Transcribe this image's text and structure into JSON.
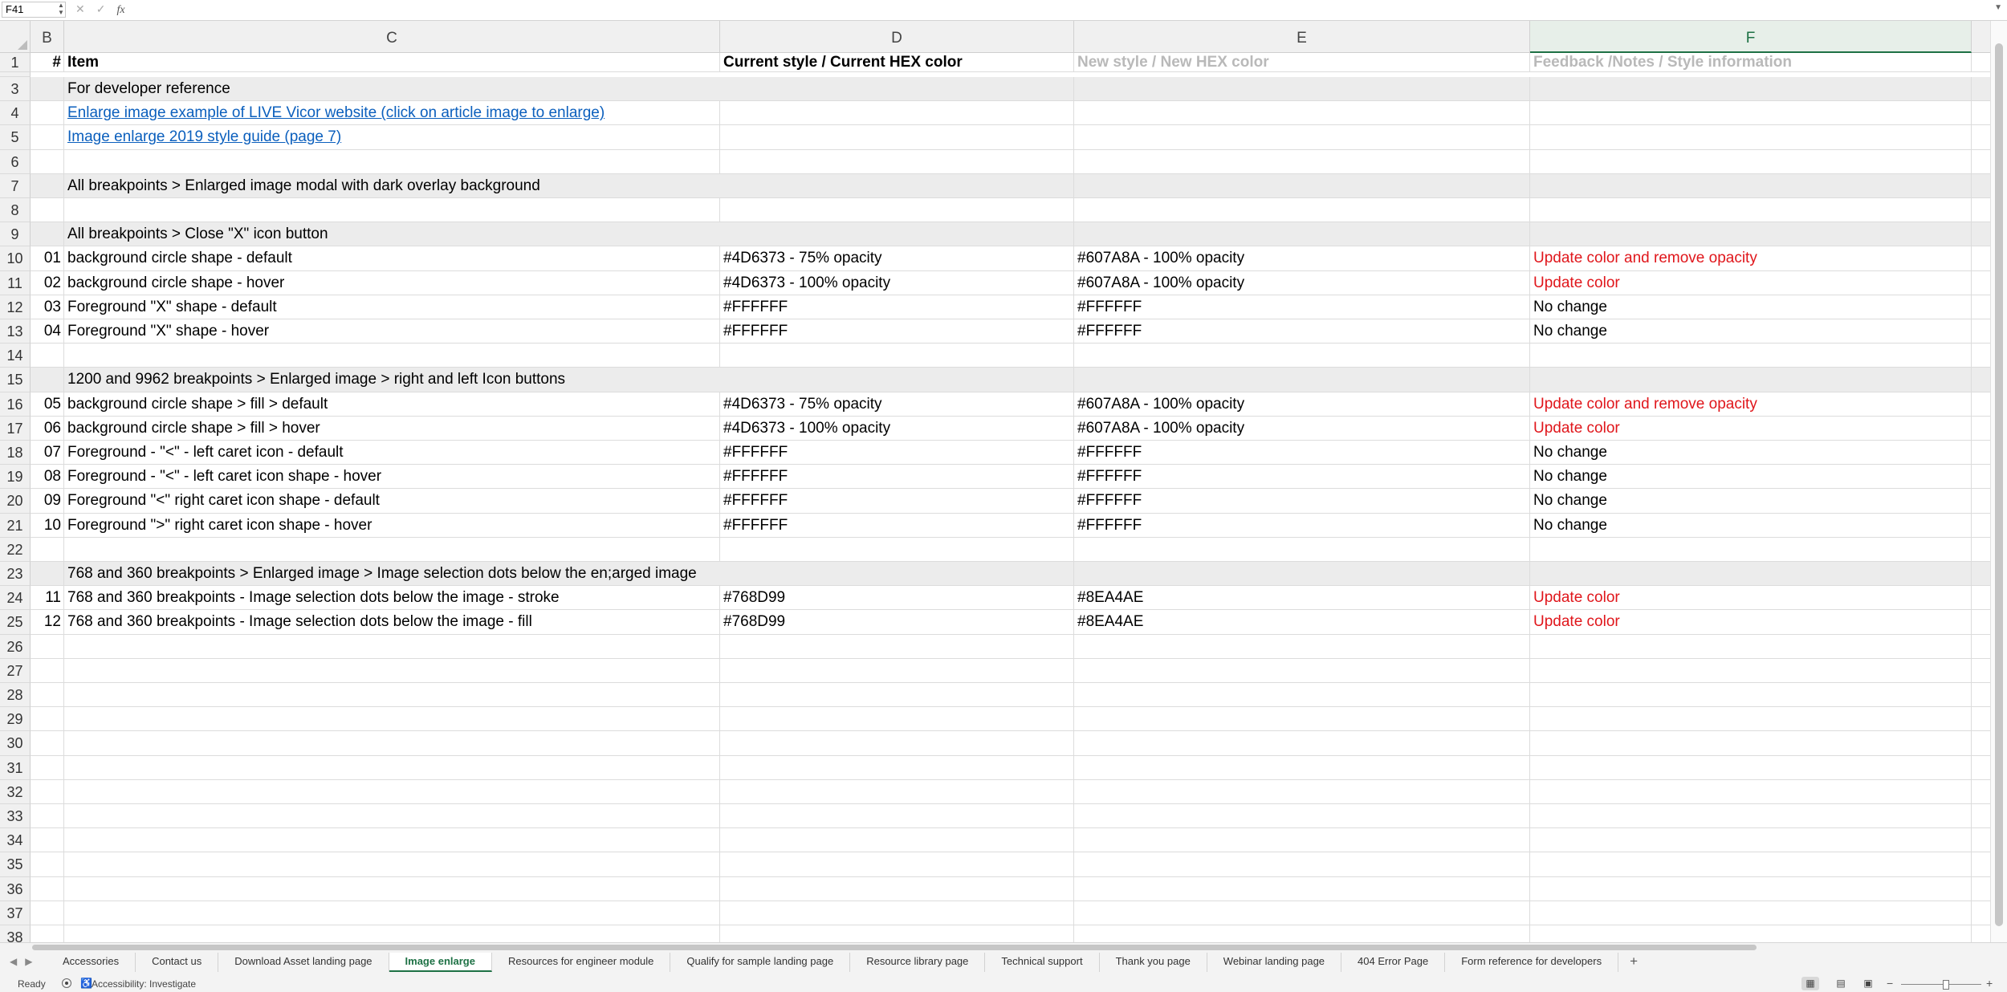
{
  "formula_bar": {
    "name_box": "F41",
    "formula": ""
  },
  "columns": [
    {
      "id": "col-b",
      "label": "B",
      "active": false
    },
    {
      "id": "col-c",
      "label": "C",
      "active": false
    },
    {
      "id": "col-d",
      "label": "D",
      "active": false
    },
    {
      "id": "col-e",
      "label": "E",
      "active": false
    },
    {
      "id": "col-f",
      "label": "F",
      "active": true
    }
  ],
  "rows": [
    {
      "n": "1",
      "num": "#",
      "item": "Item",
      "current": "Current style / Current HEX color",
      "new": "New style / New HEX color",
      "feedback": "Feedback /Notes / Style information",
      "kind": "header"
    },
    {
      "n": "3",
      "num": "",
      "item": "For developer reference",
      "current": "",
      "new": "",
      "feedback": "",
      "kind": "band"
    },
    {
      "n": "4",
      "num": "",
      "item": "Enlarge image example of LIVE Vicor website (click on article image to enlarge)",
      "current": "",
      "new": "",
      "feedback": "",
      "kind": "link"
    },
    {
      "n": "5",
      "num": "",
      "item": "Image enlarge 2019 style guide (page 7)",
      "current": "",
      "new": "",
      "feedback": "",
      "kind": "link"
    },
    {
      "n": "6",
      "num": "",
      "item": "",
      "current": "",
      "new": "",
      "feedback": "",
      "kind": "normal"
    },
    {
      "n": "7",
      "num": "",
      "item": "All breakpoints > Enlarged image modal with dark overlay background",
      "current": "",
      "new": "",
      "feedback": "",
      "kind": "band"
    },
    {
      "n": "8",
      "num": "",
      "item": "",
      "current": "",
      "new": "",
      "feedback": "",
      "kind": "normal"
    },
    {
      "n": "9",
      "num": "",
      "item": "All breakpoints  > Close \"X\" icon button",
      "current": "",
      "new": "",
      "feedback": "",
      "kind": "band"
    },
    {
      "n": "10",
      "num": "01",
      "item": "background circle shape - default",
      "current": "#4D6373 - 75% opacity",
      "new": "#607A8A - 100% opacity",
      "feedback": "Update color and remove opacity",
      "kind": "normal",
      "fb_red": true
    },
    {
      "n": "11",
      "num": "02",
      "item": "background circle shape - hover",
      "current": "#4D6373 - 100% opacity",
      "new": "#607A8A - 100% opacity",
      "feedback": "Update color",
      "kind": "normal",
      "fb_red": true
    },
    {
      "n": "12",
      "num": "03",
      "item": "Foreground \"X\" shape - default",
      "current": "#FFFFFF",
      "new": "#FFFFFF",
      "feedback": "No change",
      "kind": "normal"
    },
    {
      "n": "13",
      "num": "04",
      "item": "Foreground \"X\" shape - hover",
      "current": "#FFFFFF",
      "new": "#FFFFFF",
      "feedback": "No change",
      "kind": "normal"
    },
    {
      "n": "14",
      "num": "",
      "item": "",
      "current": "",
      "new": "",
      "feedback": "",
      "kind": "normal"
    },
    {
      "n": "15",
      "num": "",
      "item": "1200 and 9962 breakpoints > Enlarged image > right and left Icon buttons",
      "current": "",
      "new": "",
      "feedback": "",
      "kind": "band"
    },
    {
      "n": "16",
      "num": "05",
      "item": "background circle shape > fill > default",
      "current": "#4D6373 - 75% opacity",
      "new": "#607A8A - 100% opacity",
      "feedback": "Update color and remove opacity",
      "kind": "normal",
      "fb_red": true
    },
    {
      "n": "17",
      "num": "06",
      "item": "background circle shape > fill > hover",
      "current": "#4D6373 - 100% opacity",
      "new": "#607A8A - 100% opacity",
      "feedback": "Update color",
      "kind": "normal",
      "fb_red": true
    },
    {
      "n": "18",
      "num": "07",
      "item": "Foreground  - \"<\" - left caret icon - default",
      "current": "#FFFFFF",
      "new": "#FFFFFF",
      "feedback": "No change",
      "kind": "normal"
    },
    {
      "n": "19",
      "num": "08",
      "item": "Foreground  - \"<\" - left caret icon shape   - hover",
      "current": "#FFFFFF",
      "new": "#FFFFFF",
      "feedback": "No change",
      "kind": "normal"
    },
    {
      "n": "20",
      "num": "09",
      "item": "Foreground \"<\" right caret icon shape - default",
      "current": "#FFFFFF",
      "new": "#FFFFFF",
      "feedback": "No change",
      "kind": "normal"
    },
    {
      "n": "21",
      "num": "10",
      "item": "Foreground \">\" right caret icon  shape - hover",
      "current": "#FFFFFF",
      "new": "#FFFFFF",
      "feedback": "No change",
      "kind": "normal"
    },
    {
      "n": "22",
      "num": "",
      "item": "",
      "current": "",
      "new": "",
      "feedback": "",
      "kind": "normal"
    },
    {
      "n": "23",
      "num": "",
      "item": "768 and 360 breakpoints > Enlarged image > Image selection dots below the en;arged image",
      "current": "",
      "new": "",
      "feedback": "",
      "kind": "band"
    },
    {
      "n": "24",
      "num": "11",
      "item": "768 and 360 breakpoints - Image selection dots below the image - stroke",
      "current": "#768D99",
      "new": "#8EA4AE",
      "feedback": "Update color",
      "kind": "normal",
      "fb_red": true
    },
    {
      "n": "25",
      "num": "12",
      "item": "768 and 360 breakpoints - Image selection dots below the image - fill",
      "current": "#768D99",
      "new": "#8EA4AE",
      "feedback": "Update color",
      "kind": "normal",
      "fb_red": true
    },
    {
      "n": "26",
      "num": "",
      "item": "",
      "current": "",
      "new": "",
      "feedback": "",
      "kind": "normal"
    },
    {
      "n": "27",
      "num": "",
      "item": "",
      "current": "",
      "new": "",
      "feedback": "",
      "kind": "normal"
    },
    {
      "n": "28",
      "num": "",
      "item": "",
      "current": "",
      "new": "",
      "feedback": "",
      "kind": "normal"
    },
    {
      "n": "29",
      "num": "",
      "item": "",
      "current": "",
      "new": "",
      "feedback": "",
      "kind": "normal"
    },
    {
      "n": "30",
      "num": "",
      "item": "",
      "current": "",
      "new": "",
      "feedback": "",
      "kind": "normal"
    },
    {
      "n": "31",
      "num": "",
      "item": "",
      "current": "",
      "new": "",
      "feedback": "",
      "kind": "normal"
    },
    {
      "n": "32",
      "num": "",
      "item": "",
      "current": "",
      "new": "",
      "feedback": "",
      "kind": "normal"
    },
    {
      "n": "33",
      "num": "",
      "item": "",
      "current": "",
      "new": "",
      "feedback": "",
      "kind": "normal"
    },
    {
      "n": "34",
      "num": "",
      "item": "",
      "current": "",
      "new": "",
      "feedback": "",
      "kind": "normal"
    },
    {
      "n": "35",
      "num": "",
      "item": "",
      "current": "",
      "new": "",
      "feedback": "",
      "kind": "normal"
    },
    {
      "n": "36",
      "num": "",
      "item": "",
      "current": "",
      "new": "",
      "feedback": "",
      "kind": "normal"
    },
    {
      "n": "37",
      "num": "",
      "item": "",
      "current": "",
      "new": "",
      "feedback": "",
      "kind": "normal"
    },
    {
      "n": "38",
      "num": "",
      "item": "",
      "current": "",
      "new": "",
      "feedback": "",
      "kind": "normal"
    }
  ],
  "sheet_tabs": [
    {
      "label": "Accessories",
      "active": false
    },
    {
      "label": "Contact us",
      "active": false
    },
    {
      "label": "Download Asset landing page",
      "active": false
    },
    {
      "label": "Image enlarge",
      "active": true
    },
    {
      "label": "Resources for engineer module",
      "active": false
    },
    {
      "label": "Qualify for sample landing page",
      "active": false
    },
    {
      "label": "Resource library page",
      "active": false
    },
    {
      "label": "Technical support",
      "active": false
    },
    {
      "label": "Thank you page",
      "active": false
    },
    {
      "label": "Webinar landing page",
      "active": false
    },
    {
      "label": "404 Error Page",
      "active": false
    },
    {
      "label": "Form reference for developers",
      "active": false
    }
  ],
  "status": {
    "ready": "Ready",
    "accessibility": "Accessibility: Investigate"
  },
  "icons": {
    "add_sheet": "+",
    "cancel": "✕",
    "confirm": "✓",
    "fx": "fx"
  },
  "colors": {
    "accent_green": "#1e7145",
    "link_blue": "#0b5fbd",
    "alert_red": "#e0161b",
    "band_grey": "#ececec"
  }
}
